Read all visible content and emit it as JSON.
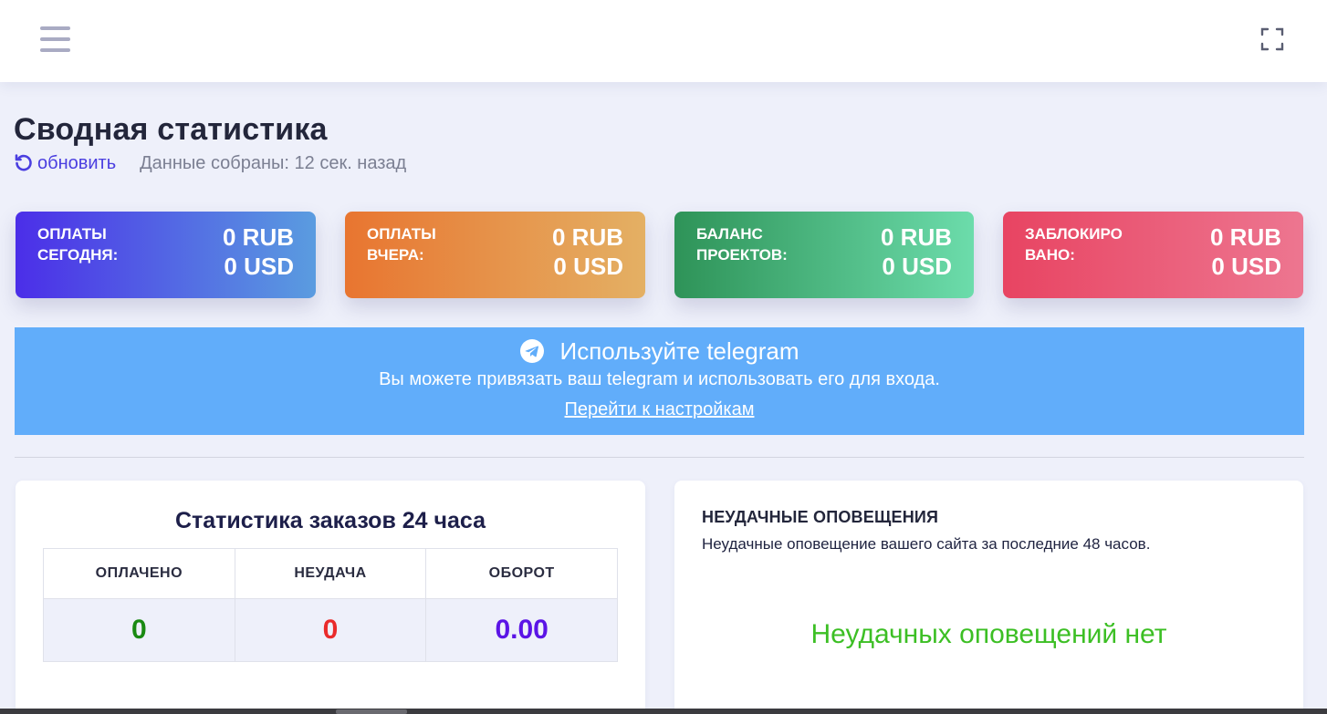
{
  "header": {
    "menu_icon": "hamburger-menu-icon",
    "fullscreen_icon": "fullscreen-icon"
  },
  "page": {
    "title": "Сводная статистика",
    "refresh_label": "обновить",
    "refresh_icon": "refresh-icon",
    "collected_text": "Данные собраны: 12 сек. назад"
  },
  "cards": [
    {
      "label": "Оплаты сегодня:",
      "rub": "0 RUB",
      "usd": "0 USD",
      "color_from": "#4b2ee8",
      "color_to": "#5a9ce0"
    },
    {
      "label": "Оплаты вчера:",
      "rub": "0 RUB",
      "usd": "0 USD",
      "color_from": "#e87530",
      "color_to": "#e4b064"
    },
    {
      "label": "Баланс проектов:",
      "rub": "0 RUB",
      "usd": "0 USD",
      "color_from": "#2e9358",
      "color_to": "#6cdcab"
    },
    {
      "label": "Заблокиро вано:",
      "rub": "0 RUB",
      "usd": "0 USD",
      "color_from": "#e84462",
      "color_to": "#ed7690"
    }
  ],
  "telegram_banner": {
    "icon": "telegram-icon",
    "title": "Используйте telegram",
    "text": "Вы можете привязать ваш telegram и использовать его для входа.",
    "link": "Перейти к настройкам",
    "background": "#61adfa"
  },
  "orders_stats": {
    "title": "Статистика заказов 24 часа",
    "columns": [
      "ОПЛАЧЕНО",
      "НЕУДАЧА",
      "ОБОРОТ"
    ],
    "values": [
      "0",
      "0",
      "0.00"
    ],
    "value_colors": [
      "#1a8a12",
      "#ea2b2b",
      "#5b14e6"
    ]
  },
  "notifications": {
    "title": "НЕУДАЧНЫЕ ОПОВЕЩЕНИЯ",
    "subtitle": "Неудачные оповещение вашего сайта за последние 48 часов.",
    "empty_text": "Неудачных оповещений нет",
    "empty_color": "#3cbf24"
  }
}
